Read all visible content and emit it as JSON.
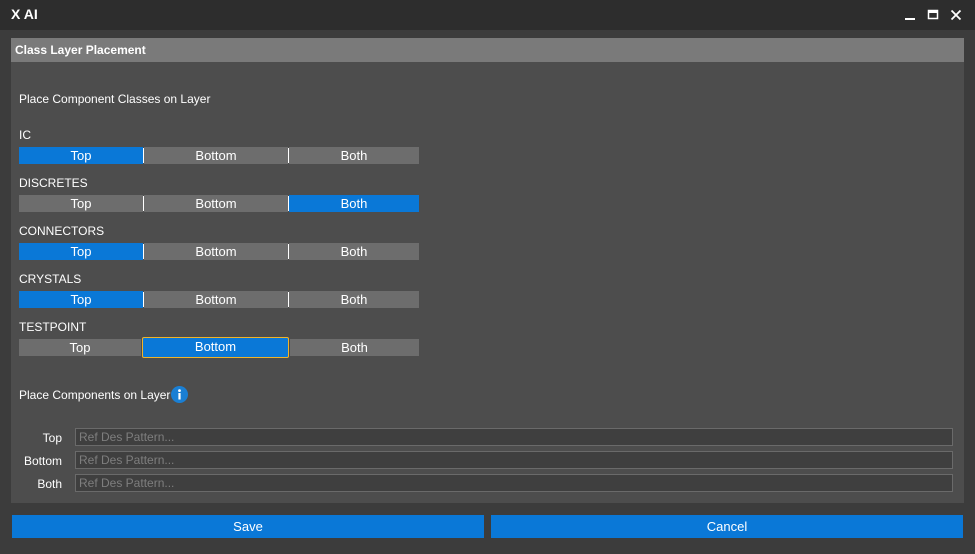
{
  "window": {
    "title": "X AI",
    "minimize_icon": "minimize-icon",
    "maximize_icon": "maximize-icon",
    "close_icon": "close-icon"
  },
  "panel": {
    "header": "Class Layer Placement",
    "section_title": "Place Component Classes on Layer",
    "options": [
      "Top",
      "Bottom",
      "Both"
    ],
    "classes": [
      {
        "name": "IC",
        "selected": "Top"
      },
      {
        "name": "DISCRETES",
        "selected": "Both"
      },
      {
        "name": "CONNECTORS",
        "selected": "Top"
      },
      {
        "name": "CRYSTALS",
        "selected": "Top"
      },
      {
        "name": "TESTPOINT",
        "selected": "Bottom",
        "focused": true
      }
    ],
    "components_title": "Place Components on Layer",
    "info_icon": "info-icon",
    "patterns": [
      {
        "label": "Top",
        "value": "",
        "placeholder": "Ref Des Pattern..."
      },
      {
        "label": "Bottom",
        "value": "",
        "placeholder": "Ref Des Pattern..."
      },
      {
        "label": "Both",
        "value": "",
        "placeholder": "Ref Des Pattern..."
      }
    ]
  },
  "actions": {
    "save": "Save",
    "cancel": "Cancel"
  },
  "colors": {
    "accent": "#0a78d7",
    "focus_border": "#f0b429",
    "segment_bg": "#6d6d6d",
    "panel_bg": "#4d4d4d",
    "header_bg": "#7a7a7a"
  }
}
